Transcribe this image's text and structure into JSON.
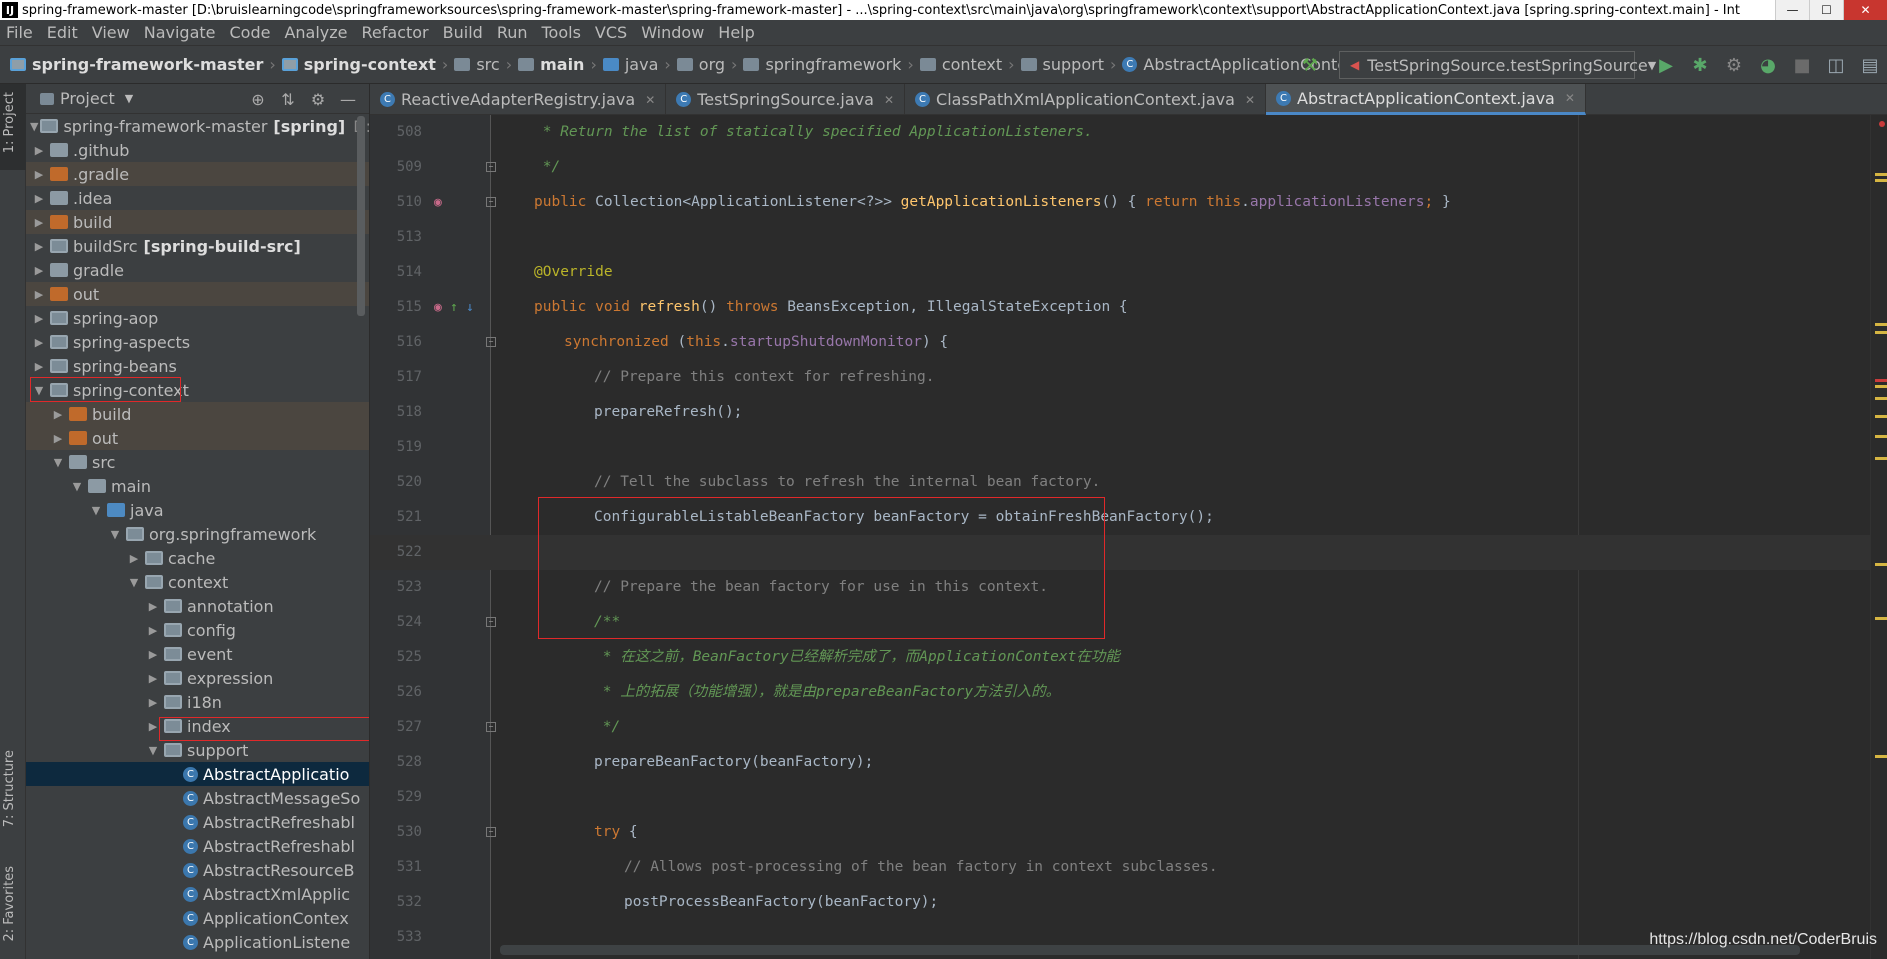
{
  "window": {
    "title": "spring-framework-master [D:\\bruislearningcode\\springframeworksources\\spring-framework-master\\spring-framework-master] - ...\\spring-context\\src\\main\\java\\org\\springframework\\context\\support\\AbstractApplicationContext.java [spring.spring-context.main] - Int",
    "app_icon": "IJ",
    "minimize": "—",
    "maximize": "☐",
    "close": "✕"
  },
  "menu": [
    "File",
    "Edit",
    "View",
    "Navigate",
    "Code",
    "Analyze",
    "Refactor",
    "Build",
    "Run",
    "Tools",
    "VCS",
    "Window",
    "Help"
  ],
  "breadcrumbs": [
    "spring-framework-master",
    "spring-context",
    "src",
    "main",
    "java",
    "org",
    "springframework",
    "context",
    "support",
    "AbstractApplicationContext"
  ],
  "run_config": {
    "label": "TestSpringSource.testSpringSource"
  },
  "toolbar_icons": [
    "build-hammer-icon",
    "run-icon",
    "debug-icon",
    "coverage-icon",
    "profile-icon",
    "stop-icon",
    "project-structure-icon",
    "layout-icon"
  ],
  "left_strip": {
    "project_tab": "1: Project",
    "structure_tab": "7: Structure",
    "favorites_tab": "2: Favorites"
  },
  "project_panel": {
    "title": "Project",
    "tree": [
      {
        "label": "spring-framework-master",
        "bold": "[spring]",
        "extra": "D:\\bruislearningcode",
        "depth": 0,
        "arrow": "▼",
        "icon": "module",
        "hl": false
      },
      {
        "label": ".github",
        "depth": 0,
        "arrow": "▶",
        "icon": "folder",
        "hl": false
      },
      {
        "label": ".gradle",
        "depth": 0,
        "arrow": "▶",
        "icon": "orange",
        "hl": true
      },
      {
        "label": ".idea",
        "depth": 0,
        "arrow": "▶",
        "icon": "folder",
        "hl": false
      },
      {
        "label": "build",
        "depth": 0,
        "arrow": "▶",
        "icon": "orange",
        "hl": true
      },
      {
        "label": "buildSrc",
        "bold": "[spring-build-src]",
        "depth": 0,
        "arrow": "▶",
        "icon": "module",
        "hl": false
      },
      {
        "label": "gradle",
        "depth": 0,
        "arrow": "▶",
        "icon": "folder",
        "hl": false
      },
      {
        "label": "out",
        "depth": 0,
        "arrow": "▶",
        "icon": "orange",
        "hl": true
      },
      {
        "label": "spring-aop",
        "depth": 0,
        "arrow": "▶",
        "icon": "module",
        "hl": false
      },
      {
        "label": "spring-aspects",
        "depth": 0,
        "arrow": "▶",
        "icon": "module",
        "hl": false
      },
      {
        "label": "spring-beans",
        "depth": 0,
        "arrow": "▶",
        "icon": "module",
        "hl": false
      },
      {
        "label": "spring-context",
        "depth": 0,
        "arrow": "▼",
        "icon": "module",
        "hl": false
      },
      {
        "label": "build",
        "depth": 1,
        "arrow": "▶",
        "icon": "orange",
        "hl": true
      },
      {
        "label": "out",
        "depth": 1,
        "arrow": "▶",
        "icon": "orange",
        "hl": true
      },
      {
        "label": "src",
        "depth": 1,
        "arrow": "▼",
        "icon": "folder",
        "hl": false
      },
      {
        "label": "main",
        "depth": 2,
        "arrow": "▼",
        "icon": "folder",
        "hl": false
      },
      {
        "label": "java",
        "depth": 3,
        "arrow": "▼",
        "icon": "blue",
        "hl": false
      },
      {
        "label": "org.springframework",
        "depth": 4,
        "arrow": "▼",
        "icon": "pkg",
        "hl": false
      },
      {
        "label": "cache",
        "depth": 5,
        "arrow": "▶",
        "icon": "pkg",
        "hl": false
      },
      {
        "label": "context",
        "depth": 5,
        "arrow": "▼",
        "icon": "pkg",
        "hl": false
      },
      {
        "label": "annotation",
        "depth": 6,
        "arrow": "▶",
        "icon": "pkg",
        "hl": false
      },
      {
        "label": "config",
        "depth": 6,
        "arrow": "▶",
        "icon": "pkg",
        "hl": false
      },
      {
        "label": "event",
        "depth": 6,
        "arrow": "▶",
        "icon": "pkg",
        "hl": false
      },
      {
        "label": "expression",
        "depth": 6,
        "arrow": "▶",
        "icon": "pkg",
        "hl": false
      },
      {
        "label": "i18n",
        "depth": 6,
        "arrow": "▶",
        "icon": "pkg",
        "hl": false
      },
      {
        "label": "index",
        "depth": 6,
        "arrow": "▶",
        "icon": "pkg",
        "hl": false
      },
      {
        "label": "support",
        "depth": 6,
        "arrow": "▼",
        "icon": "pkg",
        "hl": false
      },
      {
        "label": "AbstractApplicatio",
        "depth": 7,
        "arrow": "",
        "icon": "class",
        "hl": false,
        "selected": true
      },
      {
        "label": "AbstractMessageSo",
        "depth": 7,
        "arrow": "",
        "icon": "class",
        "hl": false
      },
      {
        "label": "AbstractRefreshabl",
        "depth": 7,
        "arrow": "",
        "icon": "class",
        "hl": false
      },
      {
        "label": "AbstractRefreshabl",
        "depth": 7,
        "arrow": "",
        "icon": "class",
        "hl": false
      },
      {
        "label": "AbstractResourceB",
        "depth": 7,
        "arrow": "",
        "icon": "class",
        "hl": false
      },
      {
        "label": "AbstractXmlApplic",
        "depth": 7,
        "arrow": "",
        "icon": "class",
        "hl": false
      },
      {
        "label": "ApplicationContex",
        "depth": 7,
        "arrow": "",
        "icon": "class",
        "hl": false
      },
      {
        "label": "ApplicationListene",
        "depth": 7,
        "arrow": "",
        "icon": "class",
        "hl": false
      }
    ]
  },
  "tabs": [
    {
      "label": "ReactiveAdapterRegistry.java",
      "active": false
    },
    {
      "label": "TestSpringSource.java",
      "active": false
    },
    {
      "label": "ClassPathXmlApplicationContext.java",
      "active": false
    },
    {
      "label": "AbstractApplicationContext.java",
      "active": true
    }
  ],
  "code_lines": [
    {
      "num": "508",
      "indent": 0,
      "parts": [
        [
          "dc",
          " * Return the list of statically specified ApplicationListeners."
        ]
      ]
    },
    {
      "num": "509",
      "indent": 0,
      "parts": [
        [
          "dc",
          " */"
        ]
      ]
    },
    {
      "num": "510",
      "indent": 0,
      "parts": [
        [
          "kw",
          "public "
        ],
        [
          "tx",
          "Collection<ApplicationListener<?>> "
        ],
        [
          "fn",
          "getApplicationListeners"
        ],
        [
          "tx",
          "() { "
        ],
        [
          "kw",
          "return this"
        ],
        [
          "tx",
          "."
        ],
        [
          "fld",
          "applicationListeners"
        ],
        [
          "kw",
          ";"
        ],
        [
          "tx",
          " }"
        ]
      ]
    },
    {
      "num": "513",
      "indent": 0,
      "parts": []
    },
    {
      "num": "514",
      "indent": 0,
      "parts": [
        [
          "ann",
          "@Override"
        ]
      ]
    },
    {
      "num": "515",
      "indent": 0,
      "parts": [
        [
          "kw",
          "public void "
        ],
        [
          "fn",
          "refresh"
        ],
        [
          "tx",
          "() "
        ],
        [
          "kw",
          "throws "
        ],
        [
          "tx",
          "BeansException, IllegalStateException {"
        ]
      ]
    },
    {
      "num": "516",
      "indent": 1,
      "parts": [
        [
          "kw",
          "synchronized "
        ],
        [
          "tx",
          "("
        ],
        [
          "kw",
          "this"
        ],
        [
          "tx",
          "."
        ],
        [
          "fld",
          "startupShutdownMonitor"
        ],
        [
          "tx",
          ") {"
        ]
      ]
    },
    {
      "num": "517",
      "indent": 2,
      "parts": [
        [
          "cm",
          "// Prepare this context for refreshing."
        ]
      ]
    },
    {
      "num": "518",
      "indent": 2,
      "parts": [
        [
          "tx",
          "prepareRefresh();"
        ]
      ]
    },
    {
      "num": "519",
      "indent": 2,
      "parts": []
    },
    {
      "num": "520",
      "indent": 2,
      "parts": [
        [
          "cm",
          "// Tell the subclass to refresh the internal bean factory."
        ]
      ]
    },
    {
      "num": "521",
      "indent": 2,
      "parts": [
        [
          "tx",
          "ConfigurableListableBeanFactory beanFactory = obtainFreshBeanFactory();"
        ]
      ]
    },
    {
      "num": "522",
      "indent": 2,
      "parts": [],
      "current": true
    },
    {
      "num": "523",
      "indent": 2,
      "parts": [
        [
          "cm",
          "// Prepare the bean factory for use in this context."
        ]
      ]
    },
    {
      "num": "524",
      "indent": 2,
      "parts": [
        [
          "dc",
          "/**"
        ]
      ]
    },
    {
      "num": "525",
      "indent": 2,
      "parts": [
        [
          "dc",
          " * 在这之前，BeanFactory已经解析完成了，而ApplicationContext在功能"
        ]
      ]
    },
    {
      "num": "526",
      "indent": 2,
      "parts": [
        [
          "dc",
          " * 上的拓展（功能增强），就是由prepareBeanFactory方法引入的。"
        ]
      ]
    },
    {
      "num": "527",
      "indent": 2,
      "parts": [
        [
          "dc",
          " */"
        ]
      ]
    },
    {
      "num": "528",
      "indent": 2,
      "parts": [
        [
          "tx",
          "prepareBeanFactory(beanFactory);"
        ]
      ]
    },
    {
      "num": "529",
      "indent": 2,
      "parts": []
    },
    {
      "num": "530",
      "indent": 2,
      "parts": [
        [
          "kw",
          "try "
        ],
        [
          "tx",
          "{"
        ]
      ]
    },
    {
      "num": "531",
      "indent": 3,
      "parts": [
        [
          "cm",
          "// Allows post-processing of the bean factory in context subclasses."
        ]
      ]
    },
    {
      "num": "532",
      "indent": 3,
      "parts": [
        [
          "tx",
          "postProcessBeanFactory(beanFactory);"
        ]
      ]
    },
    {
      "num": "533",
      "indent": 2,
      "parts": []
    }
  ],
  "watermark": "https://blog.csdn.net/CoderBruis",
  "colors": {
    "keyword": "#cc7832",
    "doc_comment": "#629755",
    "comment": "#808080",
    "annotation": "#bbb529",
    "field": "#9876aa",
    "method": "#ffc66d",
    "highlight_box": "#e0292a"
  }
}
